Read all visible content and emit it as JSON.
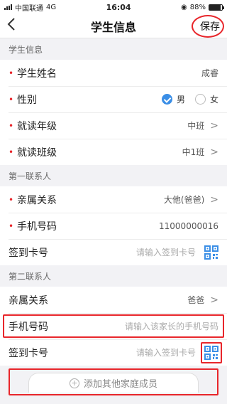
{
  "status": {
    "carrier": "中国联通",
    "network": "4G",
    "time": "16:04",
    "battery": "88%",
    "battery_level": 0.88
  },
  "nav": {
    "back": "<",
    "title": "学生信息",
    "save": "保存"
  },
  "student": {
    "section": "学生信息",
    "name_label": "学生姓名",
    "name_value": "成睿",
    "gender_label": "性别",
    "gender_male": "男",
    "gender_female": "女",
    "gender_selected": "male",
    "grade_label": "就读年级",
    "grade_value": "中班",
    "class_label": "就读班级",
    "class_value": "中1班"
  },
  "contact1": {
    "section": "第一联系人",
    "relation_label": "亲属关系",
    "relation_value": "大他(爸爸)",
    "phone_label": "手机号码",
    "phone_value": "11000000016",
    "card_label": "签到卡号",
    "card_placeholder": "请输入签到卡号"
  },
  "contact2": {
    "section": "第二联系人",
    "relation_label": "亲属关系",
    "relation_value": "爸爸",
    "phone_label": "手机号码",
    "phone_placeholder": "请输入该家长的手机号码",
    "card_label": "签到卡号",
    "card_placeholder": "请输入签到卡号"
  },
  "add_member": {
    "icon": "+",
    "label": "添加其他家庭成员"
  },
  "required_mark": "•",
  "chevron": ">",
  "icons": {
    "back": "chevron-left-icon",
    "qr": "qr-scan-icon",
    "check": "check-icon",
    "add": "plus-circle-icon"
  },
  "colors": {
    "accent": "#3a8ee6",
    "required": "#e8262b",
    "highlight": "#e8262b"
  }
}
